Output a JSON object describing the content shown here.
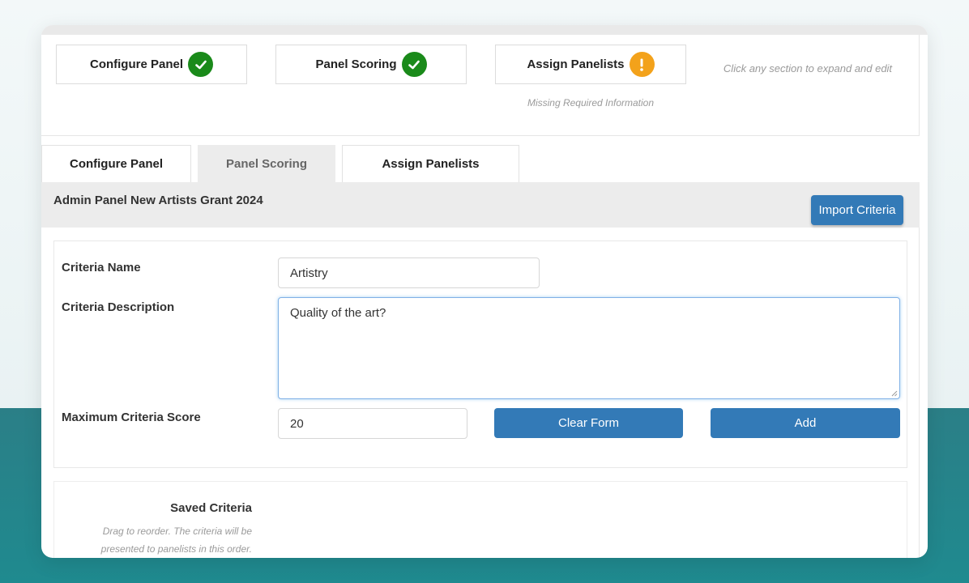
{
  "steps": [
    {
      "label": "Configure Panel",
      "status": "complete",
      "icon": "check-icon",
      "color": "#1a8a1a"
    },
    {
      "label": "Panel Scoring",
      "status": "complete",
      "icon": "check-icon",
      "color": "#1a8a1a"
    },
    {
      "label": "Assign Panelists",
      "status": "warning",
      "icon": "exclamation-icon",
      "color": "#f3a21b",
      "note": "Missing Required Information"
    }
  ],
  "hint": "Click any section to expand and edit",
  "tabs": [
    {
      "label": "Configure Panel",
      "active": false
    },
    {
      "label": "Panel Scoring",
      "active": true
    },
    {
      "label": "Assign Panelists",
      "active": false
    }
  ],
  "header": {
    "title": "Admin Panel New Artists Grant 2024",
    "import_label": "Import Criteria"
  },
  "form": {
    "name_label": "Criteria Name",
    "name_value": "Artistry",
    "description_label": "Criteria Description",
    "description_value": "Quality of the art?",
    "max_score_label": "Maximum Criteria Score",
    "max_score_value": "20",
    "clear_label": "Clear Form",
    "add_label": "Add"
  },
  "saved": {
    "title": "Saved Criteria",
    "note": "Drag to reorder. The criteria will be presented to panelists in this order."
  },
  "colors": {
    "accent": "#337ab7",
    "success": "#1a8a1a",
    "warning": "#f3a21b",
    "background_teal": "#1f8a8f"
  }
}
